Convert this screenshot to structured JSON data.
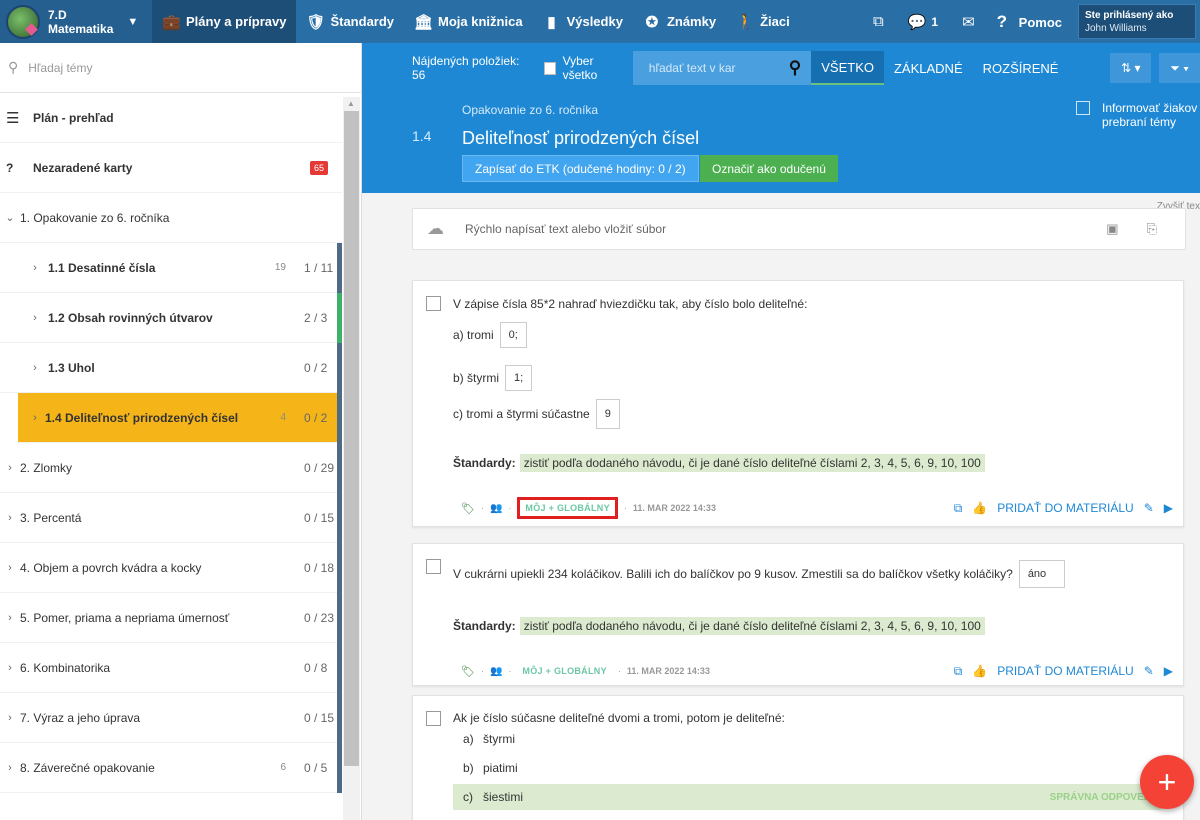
{
  "header": {
    "class_name": "7.D",
    "subject": "Matematika",
    "nav": [
      {
        "label": "Plány a prípravy",
        "icon": "briefcase-icon"
      },
      {
        "label": "Štandardy",
        "icon": "shield-icon"
      },
      {
        "label": "Moja knižnica",
        "icon": "library-icon"
      },
      {
        "label": "Výsledky",
        "icon": "bar-chart-icon"
      },
      {
        "label": "Známky",
        "icon": "grade-icon"
      },
      {
        "label": "Žiaci",
        "icon": "students-icon"
      }
    ],
    "message_count": "1",
    "help_label": "Pomoc",
    "signed_in_label": "Ste prihlásený ako",
    "user_name": "John Williams"
  },
  "sidebar": {
    "search_placeholder": "Hľadaj témy",
    "overview_label": "Plán - prehľad",
    "unsorted_label": "Nezaradené karty",
    "unsorted_count": "65",
    "chapters": [
      {
        "label": "1. Opakovanie zo 6. ročníka",
        "count": ""
      },
      {
        "label": "2. Zlomky",
        "count": "0 / 29"
      },
      {
        "label": "3. Percentá",
        "count": "0 / 15"
      },
      {
        "label": "4. Objem a povrch kvádra a kocky",
        "count": "0 / 18"
      },
      {
        "label": "5. Pomer, priama a nepriama úmernosť",
        "count": "0 / 23"
      },
      {
        "label": "6. Kombinatorika",
        "count": "0 / 8"
      },
      {
        "label": "7. Výraz a jeho úprava",
        "count": "0 / 15"
      },
      {
        "label": "8. Záverečné opakovanie",
        "num": "6",
        "count": "0 / 5"
      }
    ],
    "topics": [
      {
        "label": "1.1  Desatinné čísla",
        "num": "19",
        "count": "1 / 11"
      },
      {
        "label": "1.2  Obsah rovinných útvarov",
        "num": "",
        "count": "2 / 3"
      },
      {
        "label": "1.3  Uhol",
        "num": "",
        "count": "0 / 2"
      },
      {
        "label": "1.4  Deliteľnosť prirodzených čísel",
        "num": "4",
        "count": "0 / 2"
      }
    ]
  },
  "toolbar": {
    "found_label": "Nájdených položiek: 56",
    "select_all": "Vyber všetko",
    "search_placeholder": "hľadať text v kar",
    "tabs": [
      "VŠETKO",
      "ZÁKLADNÉ",
      "ROZŠÍRENÉ"
    ]
  },
  "topic": {
    "chapter": "Opakovanie zo 6. ročníka",
    "number": "1.4",
    "title": "Deliteľnosť prirodzených čísel",
    "etk_button": "Zapísať do ETK (odučené hodiny: 0 / 2)",
    "taught_button": "Označiť ako odučenú",
    "inform_label_1": "Informovať žiakov",
    "inform_label_2": "prebraní témy"
  },
  "quick_input": {
    "placeholder": "Rýchlo napísať text alebo vložiť súbor",
    "hint": "Zvyšiť tex"
  },
  "cards": [
    {
      "question": "V zápise čísla 85*2 nahraď hviezdičku tak, aby číslo bolo deliteľné:",
      "answers": [
        {
          "label": "a) tromi",
          "value": "0;"
        },
        {
          "label": "b) štyrmi",
          "value": "1;"
        },
        {
          "label": "c) tromi a štyrmi súčastne",
          "value": "9"
        }
      ],
      "standard_label": "Štandardy:",
      "standard": "zistiť podľa dodaného návodu, či je dané číslo deliteľné číslami 2, 3, 4, 5, 6, 9, 10, 100",
      "visibility": "MÔJ + GLOBÁLNY",
      "date": "11. MAR 2022 14:33",
      "add_label": "PRIDAŤ DO MATERIÁLU"
    },
    {
      "question": "V cukrárni upiekli 234 koláčikov. Balili ich do balíčkov po 9 kusov. Zmestili sa do balíčkov všetky koláčiky?",
      "answer": "áno",
      "standard_label": "Štandardy:",
      "standard": "zistiť podľa dodaného návodu, či je dané číslo deliteľné číslami 2, 3, 4, 5, 6, 9, 10, 100",
      "visibility": "MÔJ + GLOBÁLNY",
      "date": "11. MAR 2022 14:33",
      "add_label": "PRIDAŤ DO MATERIÁLU"
    },
    {
      "question": "Ak je číslo súčasne deliteľné dvomi a tromi, potom je deliteľné:",
      "options": [
        {
          "letter": "a)",
          "text": "štyrmi"
        },
        {
          "letter": "b)",
          "text": "piatimi"
        },
        {
          "letter": "c)",
          "text": "šiestimi"
        }
      ],
      "correct_label": "SPRÁVNA ODPOVEĎ"
    }
  ],
  "fab": "+"
}
